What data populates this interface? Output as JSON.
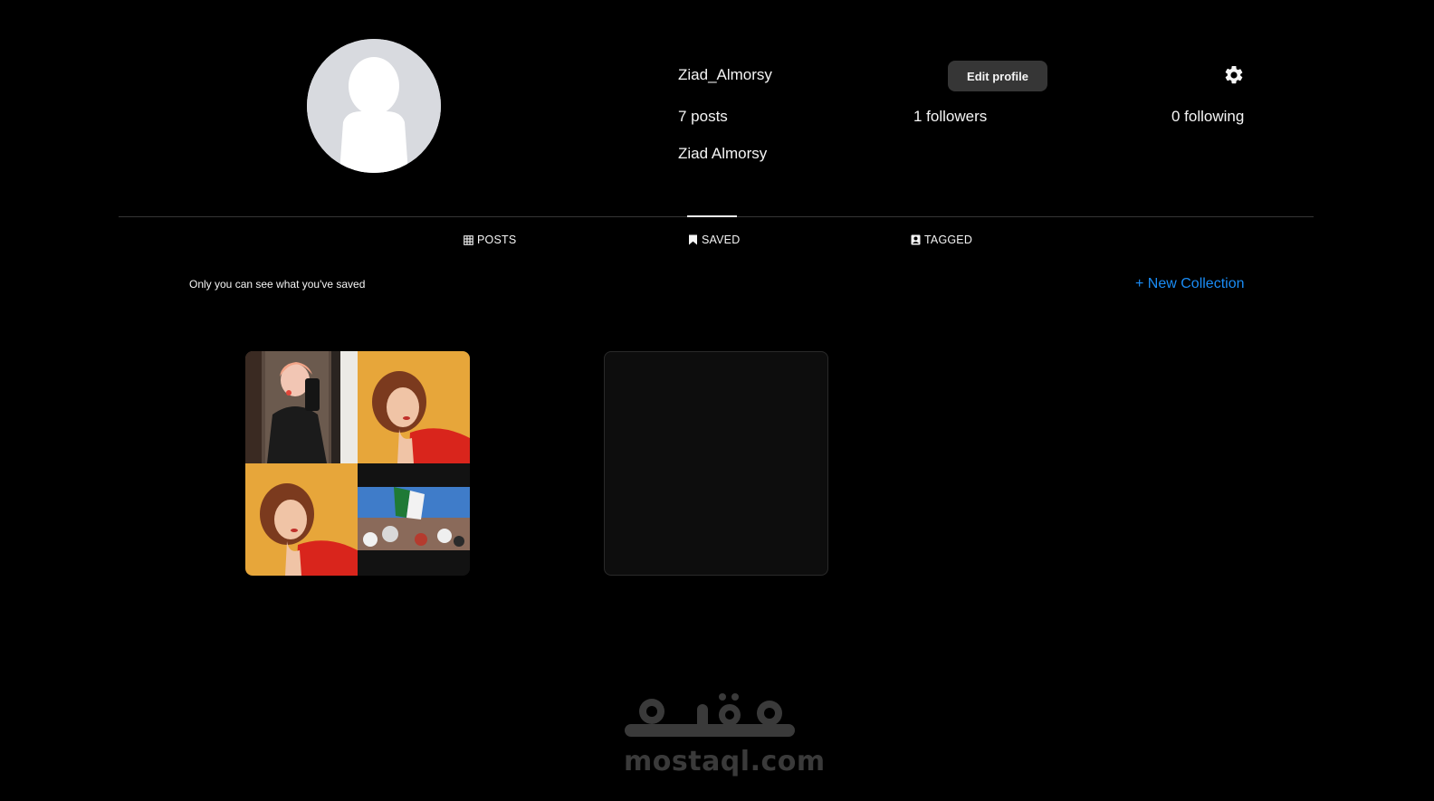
{
  "profile": {
    "username": "Ziad_Almorsy",
    "full_name": "Ziad Almorsy",
    "edit_label": "Edit profile",
    "stats": {
      "posts": "7 posts",
      "followers": "1 followers",
      "following": "0 following"
    }
  },
  "tabs": [
    {
      "label": "POSTS",
      "icon": "grid-icon",
      "active": false
    },
    {
      "label": "SAVED",
      "icon": "bookmark-icon",
      "active": true
    },
    {
      "label": "TAGGED",
      "icon": "tagged-icon",
      "active": false
    }
  ],
  "saved": {
    "private_note": "Only you can see what you've saved",
    "new_collection_label": "+ New Collection",
    "collections": [
      {
        "thumbnails": [
          "selfie-mirror-photo",
          "portrait-orange-photo",
          "portrait-orange-photo",
          "crowd-flag-photo"
        ]
      },
      {
        "thumbnails": []
      }
    ]
  },
  "watermark": {
    "text": "mostaql.com"
  },
  "colors": {
    "background": "#000000",
    "accent_link": "#1a8cf5",
    "button_bg": "#363636",
    "divider": "#363636"
  }
}
